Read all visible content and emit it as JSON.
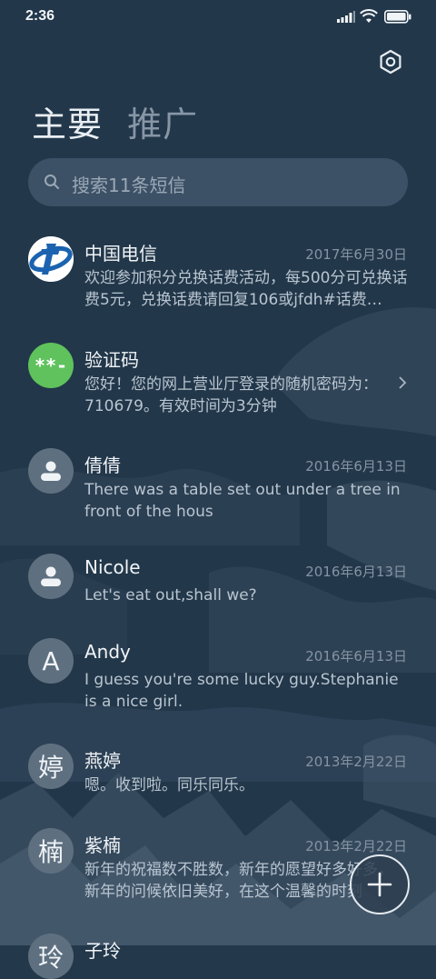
{
  "status_bar": {
    "time": "2:36"
  },
  "tabs": [
    {
      "label": "主要",
      "active": true
    },
    {
      "label": "推广",
      "active": false
    }
  ],
  "search": {
    "placeholder": "搜索11条短信"
  },
  "conversations": [
    {
      "name": "中国电信",
      "date": "2017年6月30日",
      "preview": "欢迎参加积分兑换话费活动，每500分可兑换话费5元，兑换话费请回复106或jfdh#话费…",
      "avatar": "china-telecom-logo"
    },
    {
      "name": "验证码",
      "date": "",
      "preview": "您好！您的网上营业厅登录的随机密码为：710679。有效时间为3分钟",
      "avatar": "verification-code",
      "avatar_text": "**-"
    },
    {
      "name": "倩倩",
      "date": "2016年6月13日",
      "preview": "There was a table set out under a tree in front of the hous",
      "avatar": "person-icon"
    },
    {
      "name": "Nicole",
      "date": "2016年6月13日",
      "preview": "Let's eat out,shall we?",
      "avatar": "person-icon"
    },
    {
      "name": "Andy",
      "date": "2016年6月13日",
      "preview": "I guess you're some lucky guy.Stephanie is a nice girl.",
      "avatar": "letter",
      "avatar_text": "A"
    },
    {
      "name": "燕婷",
      "date": "2013年2月22日",
      "preview": "嗯。收到啦。同乐同乐。",
      "avatar": "letter",
      "avatar_text": "婷"
    },
    {
      "name": "紫楠",
      "date": "2013年2月22日",
      "preview": "新年的祝福数不胜数，新年的愿望好多好多，新年的问候依旧美好，在这个温馨的时刻",
      "avatar": "letter",
      "avatar_text": "楠"
    },
    {
      "name": "子玲",
      "date": "",
      "preview": "",
      "avatar": "letter",
      "avatar_text": "玲"
    }
  ],
  "colors": {
    "background": "#23384b",
    "search_bg": "#3d5166",
    "avatar_gray": "#5e7080",
    "verification_green": "#5fc25c",
    "telecom_blue": "#1b63b0"
  },
  "icons": {
    "settings": "gear-icon",
    "search": "search-icon",
    "compose": "plus-icon",
    "chevron": "chevron-right-icon"
  }
}
